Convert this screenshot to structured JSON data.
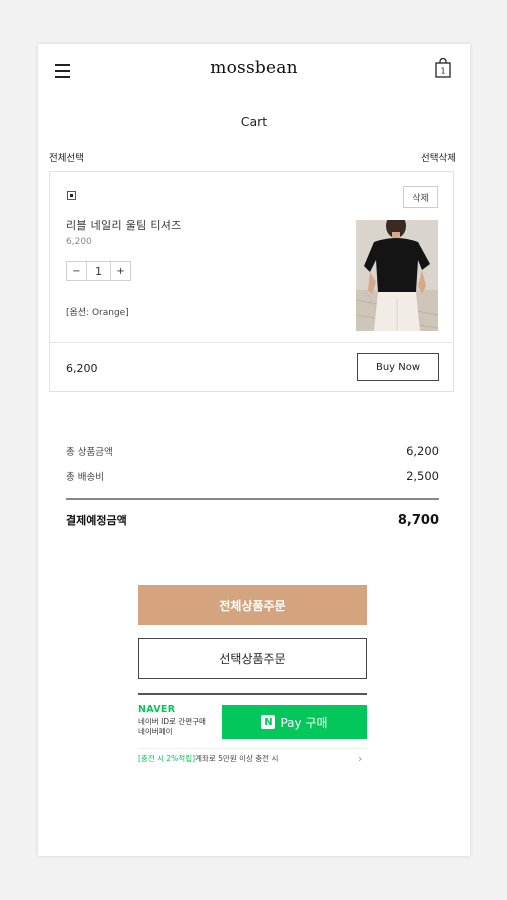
{
  "header": {
    "logo": "mossbean",
    "cart_count": "1"
  },
  "page": {
    "title": "Cart",
    "select_all": "전체선택",
    "delete_selected": "선택삭제"
  },
  "item": {
    "delete_label": "삭제",
    "name": "리블 네일리 울팀 티셔즈",
    "price": "6,200",
    "quantity": "1",
    "minus": "−",
    "plus": "+",
    "option": "[옵션: Orange]",
    "line_total": "6,200",
    "buy_now": "Buy Now"
  },
  "summary": {
    "product_total_label": "총 상품금액",
    "product_total": "6,200",
    "shipping_label": "총 배송비",
    "shipping": "2,500",
    "grand_label": "결제예정금액",
    "grand_total": "8,700"
  },
  "buttons": {
    "order_all": "전체상품주문",
    "order_selected": "선택상품주문"
  },
  "naver": {
    "logo": "NAVER",
    "desc_line1": "네이버 ID로 간편구매",
    "desc_line2": "네이버페이",
    "pay_n": "N",
    "pay_label": "Pay 구매",
    "promo_highlight": "[충전 시 2%적립]",
    "promo_rest": "계좌로 5만원 이상 충전 시",
    "promo_chevron": "›"
  },
  "colors": {
    "order_all_bg": "#d3a47d",
    "naver_green": "#03c75a"
  }
}
